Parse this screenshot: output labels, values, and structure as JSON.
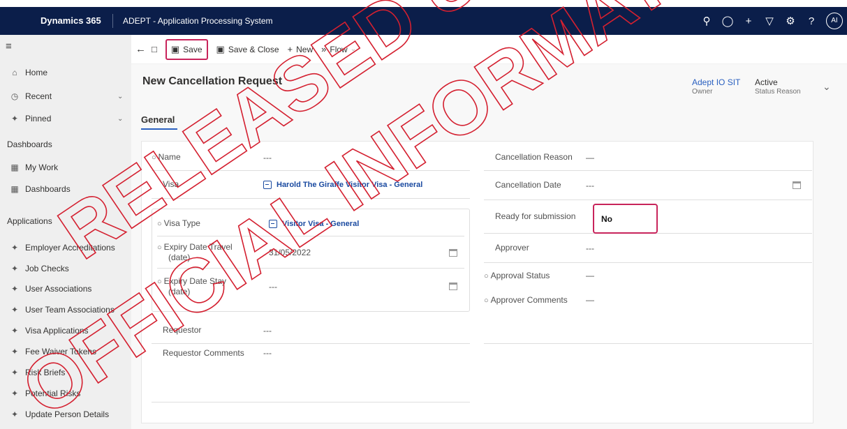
{
  "topbar": {
    "brand": "Dynamics 365",
    "app_name": "ADEPT - Application Processing System",
    "user_initials": "AI"
  },
  "sidebar": {
    "items": [
      {
        "label": "Home",
        "icon": "home-icon"
      },
      {
        "label": "Recent",
        "icon": "clock-icon"
      },
      {
        "label": "Pinned",
        "icon": "pin-icon"
      }
    ],
    "sections": [
      {
        "heading": "Dashboards",
        "items": [
          {
            "label": "My Work",
            "icon": "dashboard-icon"
          },
          {
            "label": "Dashboards",
            "icon": "dashboard-icon"
          }
        ]
      },
      {
        "heading": "Applications",
        "items": [
          {
            "label": "Employer Accreditations",
            "icon": "puzzle-icon"
          },
          {
            "label": "Job Checks",
            "icon": "puzzle-icon"
          },
          {
            "label": "User Associations",
            "icon": "puzzle-icon"
          },
          {
            "label": "User Team Associations",
            "icon": "puzzle-icon"
          },
          {
            "label": "Visa Applications",
            "icon": "puzzle-icon"
          },
          {
            "label": "Fee Waiver Tokens",
            "icon": "puzzle-icon"
          },
          {
            "label": "Risk Briefs",
            "icon": "puzzle-icon"
          },
          {
            "label": "Potential Risks",
            "icon": "puzzle-icon"
          },
          {
            "label": "Update Person Details",
            "icon": "puzzle-icon"
          }
        ]
      }
    ]
  },
  "cmdbar": {
    "save": "Save",
    "save_close": "Save & Close",
    "new": "New",
    "flow": "Flow"
  },
  "form": {
    "title": "New Cancellation Request",
    "owner_value": "Adept IO SIT",
    "owner_label": "Owner",
    "status_value": "Active",
    "status_label": "Status Reason",
    "tab": "General",
    "left": {
      "name_label": "Name",
      "name_value": "---",
      "visa_label": "Visa",
      "visa_value": "Harold The Giraffe Visitor Visa - General",
      "visa_type_label": "Visa Type",
      "visa_type_value": "Visitor Visa - General",
      "expiry_travel_label_1": "Expiry Date Travel",
      "expiry_travel_label_2": "(date)",
      "expiry_travel_value": "31/05/2022",
      "expiry_stay_label_1": "Expiry Date Stay",
      "expiry_stay_label_2": "(date)",
      "expiry_stay_value": "---",
      "requestor_label": "Requestor",
      "requestor_value": "---",
      "requestor_comments_label": "Requestor Comments",
      "requestor_comments_value": "---"
    },
    "right": {
      "cancellation_reason_label": "Cancellation Reason",
      "cancellation_reason_value": "—",
      "cancellation_date_label": "Cancellation Date",
      "cancellation_date_value": "---",
      "ready_label": "Ready for submission",
      "ready_value": "No",
      "approver_label": "Approver",
      "approver_value": "---",
      "approval_status_label": "Approval Status",
      "approval_status_value": "—",
      "approver_comments_label": "Approver Comments",
      "approver_comments_value": "—"
    }
  },
  "watermark": {
    "line1": "RELEASED UNDER THE",
    "line2": "OFFICIAL INFORMATION ACT",
    "color": "#d42030"
  }
}
